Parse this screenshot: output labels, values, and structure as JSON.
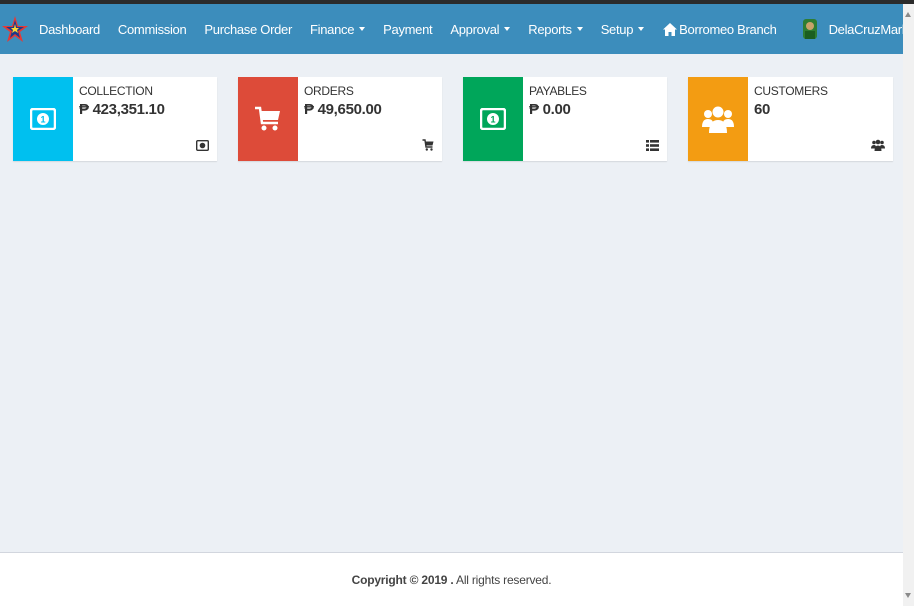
{
  "nav": {
    "brand_icon": "star-logo-icon",
    "items": [
      {
        "label": "Dashboard",
        "dropdown": false
      },
      {
        "label": "Commission",
        "dropdown": false
      },
      {
        "label": "Purchase Order",
        "dropdown": false
      },
      {
        "label": "Finance",
        "dropdown": true
      },
      {
        "label": "Payment",
        "dropdown": false
      },
      {
        "label": "Approval",
        "dropdown": true
      },
      {
        "label": "Reports",
        "dropdown": true
      },
      {
        "label": "Setup",
        "dropdown": true
      }
    ],
    "branch": "Borromeo Branch",
    "user": "DelaCruzMarkJones",
    "color": "#3c8dbc"
  },
  "boxes": [
    {
      "label": "COLLECTION",
      "value": "₱ 423,351.10",
      "color": "#00c0ef",
      "icon": "money-icon",
      "mini_icon": "money-mini-icon"
    },
    {
      "label": "ORDERS",
      "value": "₱ 49,650.00",
      "color": "#dd4b39",
      "icon": "cart-icon",
      "mini_icon": "cart-mini-icon"
    },
    {
      "label": "PAYABLES",
      "value": "₱ 0.00",
      "color": "#00a65a",
      "icon": "money-icon",
      "mini_icon": "list-icon"
    },
    {
      "label": "CUSTOMERS",
      "value": "60",
      "color": "#f39c12",
      "icon": "users-icon",
      "mini_icon": "users-mini-icon"
    }
  ],
  "footer": {
    "copyright": "Copyright © 2019 .",
    "rights": " All rights reserved."
  }
}
